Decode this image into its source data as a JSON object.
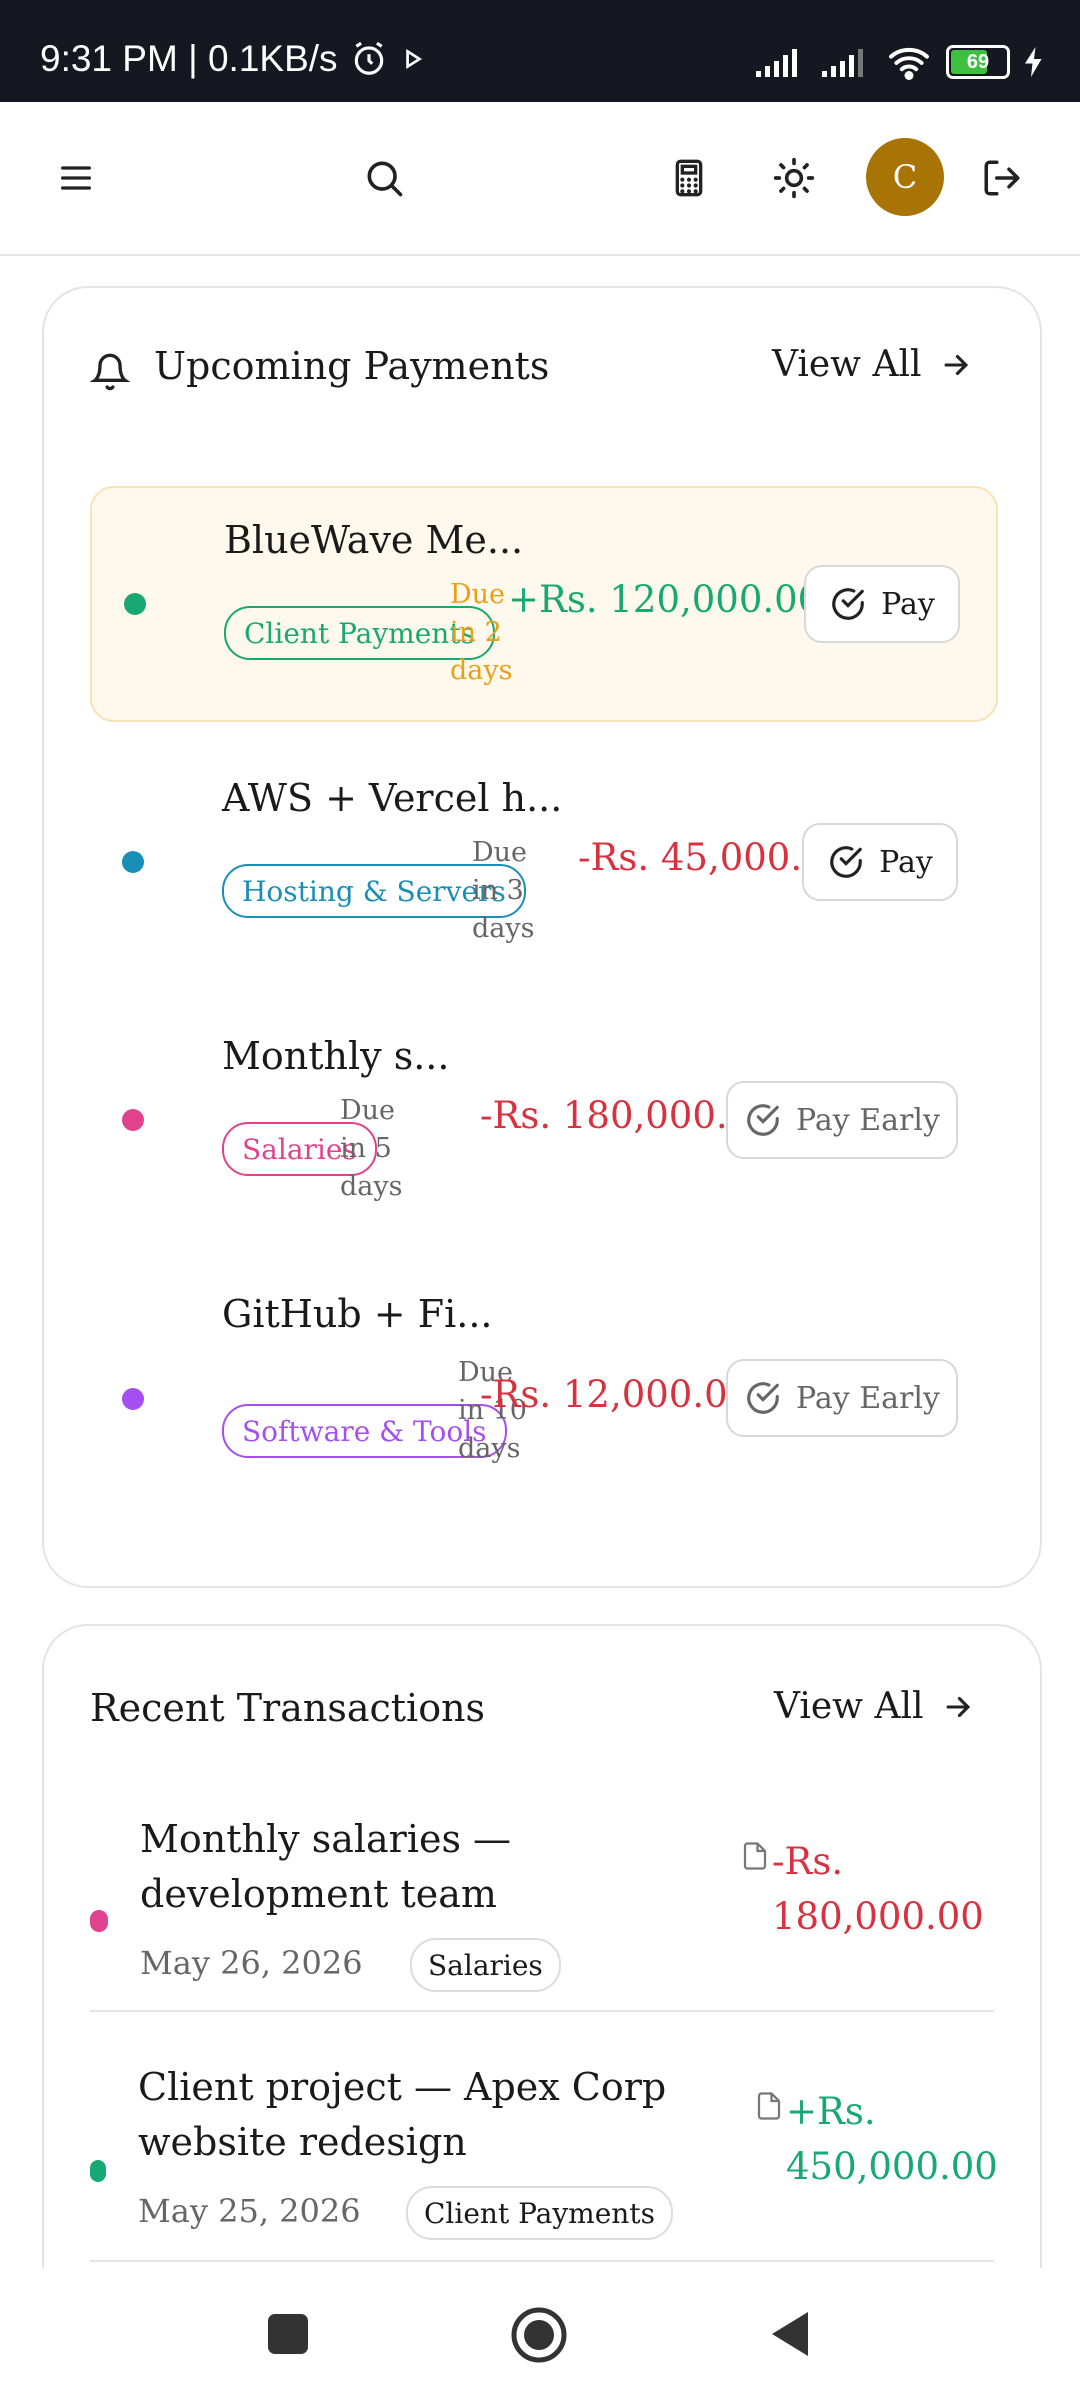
{
  "status_bar": {
    "time_speed": "9:31 PM | 0.1KB/s",
    "battery": "69"
  },
  "colors": {
    "green": "#18a874",
    "red": "#d8313f",
    "amber": "#e8a117",
    "teal": "#1a8fb5",
    "pink": "#e0428e",
    "purple": "#a64ff0",
    "avatar": "#a97406"
  },
  "app_bar": {
    "icons": [
      "menu-icon",
      "search-icon",
      "calculator-icon",
      "theme-toggle-icon",
      "logout-icon"
    ],
    "avatar_initial": "C"
  },
  "upcoming": {
    "title": "Upcoming Payments",
    "view_all": "View All",
    "items": [
      {
        "name": "BlueWave Me...",
        "category": "Client Payments",
        "due": "Due in 2 days",
        "amount": "+Rs. 120,000.00",
        "action": "Pay",
        "highlighted": true
      },
      {
        "name": "AWS + Vercel h...",
        "category": "Hosting & Servers",
        "due": "Due in 3 days",
        "amount": "-Rs. 45,000.00",
        "action": "Pay",
        "highlighted": false
      },
      {
        "name": "Monthly s...",
        "category": "Salaries",
        "due": "Due in 5 days",
        "amount": "-Rs. 180,000.00",
        "action": "Pay Early",
        "highlighted": false
      },
      {
        "name": "GitHub + Fi...",
        "category": "Software & Tools",
        "due": "Due in 10 days",
        "amount": "-Rs. 12,000.00",
        "action": "Pay Early",
        "highlighted": false
      }
    ]
  },
  "recent": {
    "title": "Recent Transactions",
    "view_all": "View All",
    "items": [
      {
        "name": "Monthly salaries — development team",
        "date": "May 26, 2026",
        "category": "Salaries",
        "amount": "-Rs. 180,000.00"
      },
      {
        "name": "Client project — Apex Corp website redesign",
        "date": "May 25, 2026",
        "category": "Client Payments",
        "amount": "+Rs. 450,000.00"
      }
    ]
  }
}
